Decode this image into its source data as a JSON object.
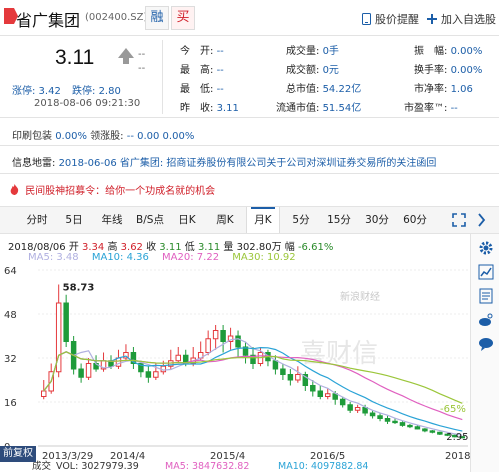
{
  "header": {
    "name": "省广集团",
    "code": "(002400.SZ)",
    "tag_rong": "融",
    "tag_mai": "买",
    "alert_link": "股价提醒",
    "add_link": "加入自选股"
  },
  "quote": {
    "price": "3.11",
    "change": "--",
    "change_pct": "--",
    "limit_up": "涨停: 3.42",
    "limit_down": "跌停: 2.80",
    "time": "2018-08-06 09:21:30",
    "fields": [
      {
        "label": "今　开:",
        "value": "--"
      },
      {
        "label": "最　高:",
        "value": "--"
      },
      {
        "label": "最　低:",
        "value": "--"
      },
      {
        "label": "昨　收:",
        "value": "3.11"
      },
      {
        "label": "成交量:",
        "value": "0手"
      },
      {
        "label": "成交额:",
        "value": "0元"
      },
      {
        "label": "总市值:",
        "value": "54.22亿"
      },
      {
        "label": "流通市值:",
        "value": "51.54亿"
      },
      {
        "label": "振　幅:",
        "value": "0.00%"
      },
      {
        "label": "换手率:",
        "value": "0.00%"
      },
      {
        "label": "市净率:",
        "value": "1.06"
      },
      {
        "label": "市盈率™:",
        "value": "--"
      }
    ]
  },
  "pledge": {
    "label1": "印刷包装",
    "value1": "0.00%",
    "label2": "领涨股:",
    "value2": "-- 0.00 0.00%"
  },
  "info": {
    "label": "信息地雷:",
    "text": "2018-06-06 省广集团: 招商证券股份有限公司关于公司对深圳证券交易所的关注函回"
  },
  "promo": {
    "text": "民间股神招募令：给你一个功成名就的机会"
  },
  "tabs": [
    "分时",
    "5日",
    "年线",
    "B/S点",
    "日K",
    "周K",
    "月K",
    "5分",
    "15分",
    "30分",
    "60分"
  ],
  "active_tab": "月K",
  "ohlc": {
    "date": "2018/08/06",
    "open_label": "开",
    "open": "3.34",
    "high_label": "高",
    "high": "3.62",
    "close_label": "收",
    "close": "3.11",
    "low_label": "低",
    "low": "3.11",
    "vol_label": "量",
    "vol": "302.80万",
    "chg_label": "幅",
    "chg": "-6.61%"
  },
  "ma": [
    {
      "label": "MA5: 3.48",
      "color": "#b0b0e0"
    },
    {
      "label": "MA10: 4.36",
      "color": "#2aa3d6"
    },
    {
      "label": "MA20: 7.22",
      "color": "#e060c0"
    },
    {
      "label": "MA30: 10.92",
      "color": "#9bc63a"
    }
  ],
  "chart_data": {
    "type": "candlestick",
    "y_ticks": [
      "64",
      "48",
      "32",
      "16",
      "0"
    ],
    "ylim": [
      0,
      64
    ],
    "x_ticks": [
      "2013/3/29",
      "2014/4",
      "2015/4",
      "2016/5",
      "2018/8/6"
    ],
    "annotations": {
      "max": "58.73",
      "min": "2.95",
      "pct": "-65%"
    },
    "watermark_brand": "新浪财经",
    "watermark_text": "喜财信",
    "candles": [
      [
        18,
        20,
        24,
        17
      ],
      [
        20,
        27,
        30,
        19
      ],
      [
        27,
        52,
        58.73,
        25
      ],
      [
        52,
        38,
        55,
        36
      ],
      [
        38,
        28,
        40,
        26
      ],
      [
        28,
        25,
        30,
        23
      ],
      [
        25,
        30,
        32,
        24
      ],
      [
        30,
        28,
        33,
        27
      ],
      [
        28,
        31,
        34,
        27
      ],
      [
        31,
        29,
        33,
        28
      ],
      [
        29,
        32,
        35,
        28
      ],
      [
        32,
        34,
        37,
        31
      ],
      [
        34,
        30,
        36,
        28
      ],
      [
        30,
        27,
        31,
        25
      ],
      [
        27,
        25,
        29,
        23
      ],
      [
        25,
        27,
        30,
        24
      ],
      [
        27,
        29,
        31,
        26
      ],
      [
        29,
        31,
        35,
        28
      ],
      [
        31,
        33,
        36,
        30
      ],
      [
        33,
        30,
        35,
        29
      ],
      [
        30,
        32,
        36,
        29
      ],
      [
        32,
        34,
        38,
        31
      ],
      [
        34,
        39,
        42,
        33
      ],
      [
        39,
        42,
        44,
        35
      ],
      [
        42,
        38,
        44,
        34
      ],
      [
        38,
        40,
        43,
        35
      ],
      [
        40,
        36,
        42,
        32
      ],
      [
        36,
        33,
        38,
        30
      ],
      [
        33,
        30,
        36,
        28
      ],
      [
        30,
        34,
        36,
        29
      ],
      [
        34,
        31,
        35,
        29
      ],
      [
        31,
        28,
        33,
        26
      ],
      [
        28,
        26,
        30,
        24
      ],
      [
        26,
        24,
        28,
        22
      ],
      [
        24,
        26,
        29,
        23
      ],
      [
        26,
        22,
        27,
        20
      ],
      [
        22,
        20,
        24,
        18
      ],
      [
        20,
        18,
        22,
        17
      ],
      [
        18,
        19,
        21,
        17
      ],
      [
        19,
        17,
        20,
        15
      ],
      [
        17,
        15,
        18,
        14
      ],
      [
        15,
        13,
        16,
        12
      ],
      [
        13,
        14,
        15,
        12
      ],
      [
        14,
        12,
        15,
        11
      ],
      [
        12,
        11,
        13,
        10
      ],
      [
        11,
        10,
        12,
        9
      ],
      [
        10,
        9,
        11,
        8
      ],
      [
        9,
        8.5,
        10,
        8
      ],
      [
        8.5,
        7.5,
        9,
        7
      ],
      [
        7.5,
        7,
        8,
        6.5
      ],
      [
        7,
        6.2,
        7.5,
        6
      ],
      [
        6.2,
        5.5,
        6.5,
        5
      ],
      [
        5.5,
        5,
        5.8,
        4.6
      ],
      [
        5,
        4.3,
        5.2,
        4
      ],
      [
        4.3,
        3.9,
        4.6,
        3.6
      ],
      [
        3.9,
        3.34,
        4.1,
        3.1
      ],
      [
        3.34,
        3.11,
        3.62,
        2.95
      ]
    ],
    "volume": {
      "label": "成交",
      "vol_label": "VOL: 3027979.39",
      "ma5_label": "MA5: 3847632.82",
      "ma10_label": "MA10: 4097882.84"
    }
  },
  "right_tools": [
    "gear-icon",
    "chart-icon",
    "document-icon",
    "weibo-icon",
    "chat-icon"
  ],
  "fq_button": "前复权"
}
